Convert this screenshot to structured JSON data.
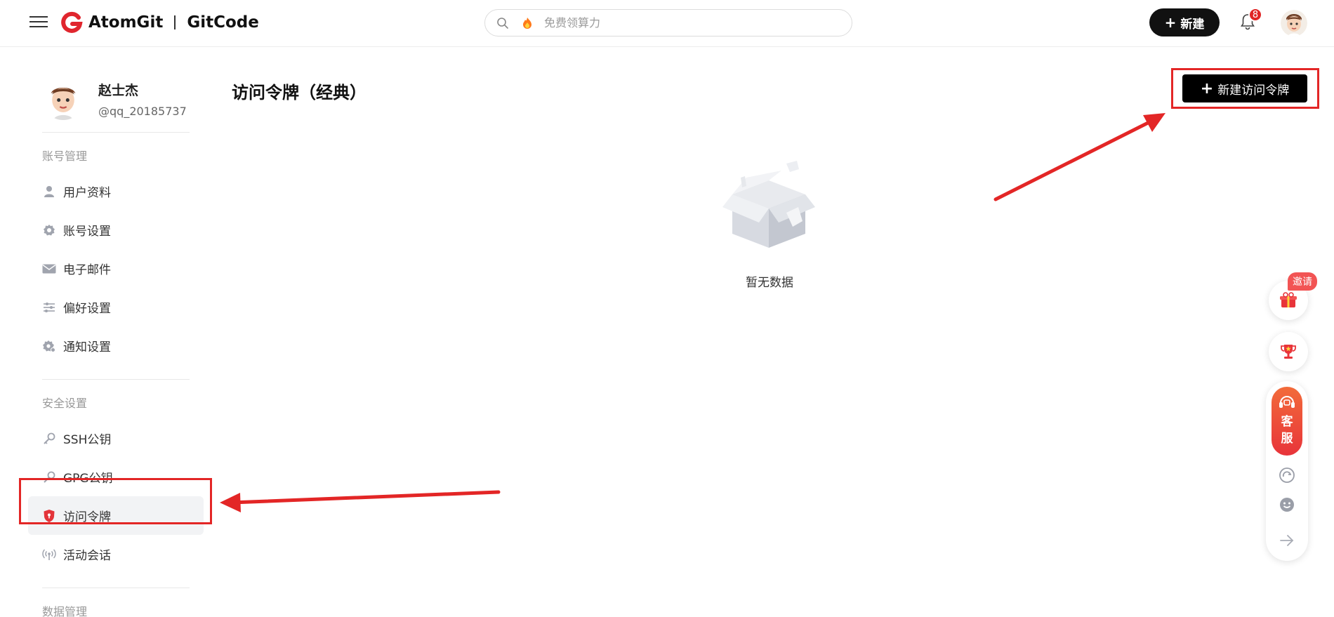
{
  "header": {
    "logo_left": "AtomGit",
    "logo_right": "GitCode",
    "search_placeholder": "免费领算力",
    "new_label": "新建",
    "notification_count": "8"
  },
  "sidebar": {
    "user_name": "赵士杰",
    "user_handle": "@qq_20185737",
    "section_account": "账号管理",
    "account_items": [
      {
        "label": "用户资料",
        "icon": "user-icon"
      },
      {
        "label": "账号设置",
        "icon": "gear-icon"
      },
      {
        "label": "电子邮件",
        "icon": "mail-icon"
      },
      {
        "label": "偏好设置",
        "icon": "sliders-icon"
      },
      {
        "label": "通知设置",
        "icon": "notification-gear-icon"
      }
    ],
    "section_security": "安全设置",
    "security_items": [
      {
        "label": "SSH公钥",
        "icon": "key-icon"
      },
      {
        "label": "GPG公钥",
        "icon": "wrench-key-icon"
      },
      {
        "label": "访问令牌",
        "icon": "shield-icon",
        "active": true
      },
      {
        "label": "活动会话",
        "icon": "broadcast-icon"
      }
    ],
    "section_data": "数据管理"
  },
  "main": {
    "title": "访问令牌（经典）",
    "create_button_label": "新建访问令牌",
    "empty_text": "暂无数据"
  },
  "float_toolbar": {
    "invite_label": "邀请",
    "service_label": "客服"
  },
  "colors": {
    "brand_red": "#e32626",
    "button_black": "#111111",
    "annotation_red": "#e32626"
  }
}
